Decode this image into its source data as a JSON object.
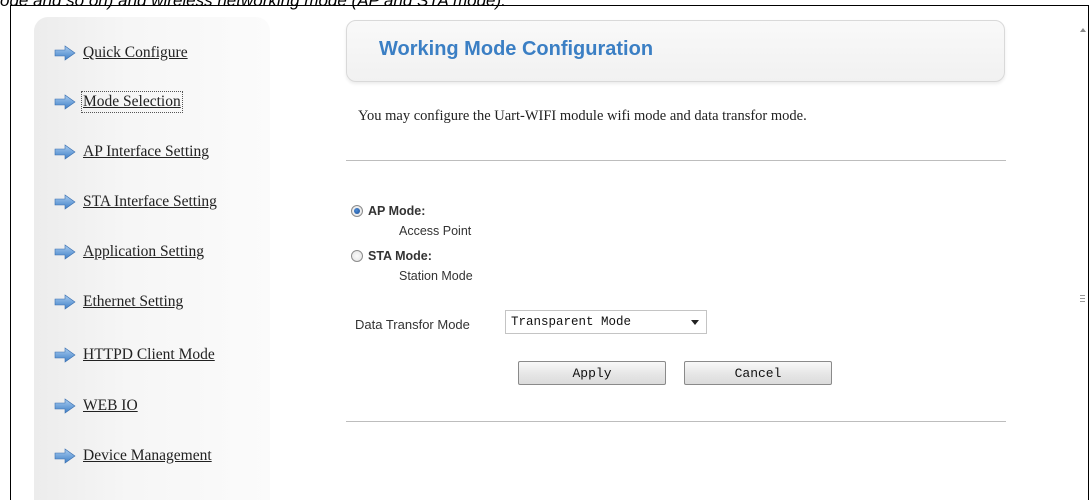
{
  "caption": "ode and so on) and wireless networking mode (AP and STA mode).",
  "sidebar": {
    "items": [
      {
        "label": "Quick Configure",
        "icon": "arrow-right-icon"
      },
      {
        "label": "Mode Selection",
        "icon": "arrow-right-icon",
        "selected": true
      },
      {
        "label": "AP Interface Setting",
        "icon": "arrow-right-icon"
      },
      {
        "label": "STA Interface Setting",
        "icon": "arrow-right-icon"
      },
      {
        "label": "Application Setting",
        "icon": "arrow-right-icon"
      },
      {
        "label": "Ethernet Setting",
        "icon": "arrow-right-icon"
      },
      {
        "label": "HTTPD Client Mode",
        "icon": "arrow-right-icon"
      },
      {
        "label": "WEB IO",
        "icon": "arrow-right-icon"
      },
      {
        "label": "Device Management",
        "icon": "arrow-right-icon"
      }
    ]
  },
  "main": {
    "title": "Working Mode Configuration",
    "description": "You may configure the Uart-WIFI module wifi mode and data transfor mode.",
    "wifi_mode": {
      "selected": "ap",
      "options": [
        {
          "key": "ap",
          "label": "AP Mode:",
          "sublabel": "Access Point"
        },
        {
          "key": "sta",
          "label": "STA Mode:",
          "sublabel": "Station Mode"
        }
      ]
    },
    "data_transfer": {
      "label": "Data Transfor Mode",
      "value": "Transparent Mode"
    },
    "buttons": {
      "apply": "Apply",
      "cancel": "Cancel"
    }
  },
  "colors": {
    "title": "#3b7fc4",
    "nav_arrow": "#5b9bd5",
    "radio_checked": "#2a64b0"
  }
}
